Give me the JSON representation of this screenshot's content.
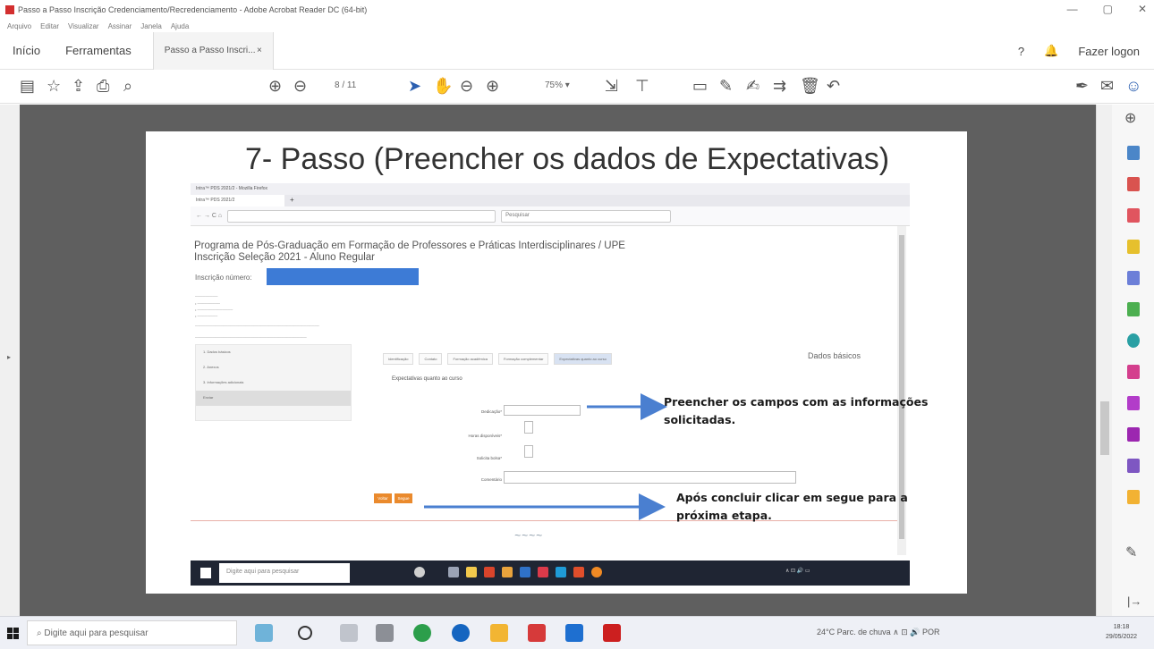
{
  "window": {
    "title": "Passo a Passo Inscrição Credenciamento/Recredenciamento - Adobe Acrobat Reader DC (64-bit)",
    "controls": [
      "—",
      "▢",
      "✕"
    ]
  },
  "menu": [
    "Arquivo",
    "Editar",
    "Visualizar",
    "Assinar",
    "Janela",
    "Ajuda"
  ],
  "tabs": {
    "home": "Início",
    "tools": "Ferramentas",
    "document": "Passo a Passo Inscri...",
    "close": "×",
    "login": "Fazer logon"
  },
  "toolbar": {
    "page_current": "8",
    "page_total": "/ 11",
    "zoom": "75%",
    "zoom_caret": "▾"
  },
  "slide": {
    "title": "7- Passo (Preencher os dados de Expectativas)"
  },
  "embedded": {
    "browser_title": "Intra™ PDS 2021/2 - Mozilla Firefox",
    "tab_label": "Intra™ PDS 2021/2",
    "tab_new": "+",
    "search_placeholder": "Pesquisar",
    "heading_line1": "Programa de Pós-Graduação em Formação de Professores e Práticas Interdisciplinares / UPE",
    "heading_line2": "Inscrição Seleção 2021 - Aluno Regular",
    "inscricao_label": "Inscrição número:",
    "dados_basicos": "Dados básicos",
    "form_title": "Expectativas quanto ao curso",
    "fields": {
      "dedicacao": "Dedicação*",
      "horas": "Horas disponíveis*",
      "bolsa": "Solicita bolsa*",
      "comentario": "Comentário"
    },
    "buttons": {
      "back": "Voltar",
      "next": "Segue"
    },
    "form_tabs": [
      "Identificação",
      "Contato",
      "Formação acadêmica",
      "Formação complementar",
      "Expectativas quanto ao curso"
    ],
    "side_items": [
      "1. Dados básicos",
      "2. Anexos",
      "3. Informações adicionais",
      "Enviar"
    ],
    "inner_search": "Digite aqui para pesquisar"
  },
  "annotations": {
    "fill_fields": "Preencher os campos com as informações solicitadas.",
    "after_done": "Após concluir clicar em segue para a próxima etapa."
  },
  "taskbar": {
    "search_placeholder": "Digite aqui para pesquisar",
    "weather": "24°C Parc. de chuva",
    "lang": "POR",
    "time": "18:18",
    "date": "29/05/2022"
  },
  "colors": {
    "acrobat_blue": "#2b5fb0",
    "doc_bg": "#5f5f5f",
    "mask_blue": "#3d7bd6",
    "button_orange": "#ea8a2d",
    "arrow_blue": "#4a7fd0"
  }
}
